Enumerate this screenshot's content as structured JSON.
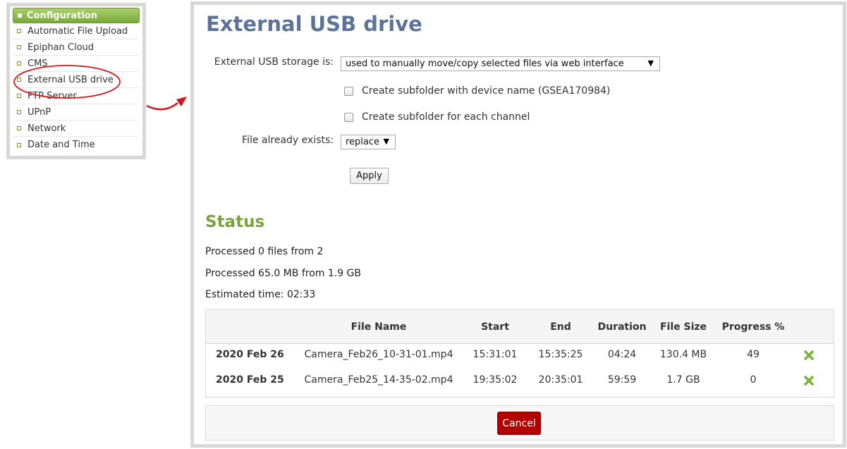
{
  "nav": {
    "header": "Configuration",
    "items": [
      {
        "label": "Automatic File Upload"
      },
      {
        "label": "Epiphan Cloud"
      },
      {
        "label": "CMS"
      },
      {
        "label": "External USB drive"
      },
      {
        "label": "FTP Server"
      },
      {
        "label": "UPnP"
      },
      {
        "label": "Network"
      },
      {
        "label": "Date and Time"
      }
    ]
  },
  "page": {
    "title": "External USB drive",
    "storage_label": "External USB storage is:",
    "storage_value": "used to manually move/copy selected files via web interface",
    "subfolder_device_label": "Create subfolder with device name (GSEA170984)",
    "subfolder_channel_label": "Create subfolder for each channel",
    "file_exists_label": "File already exists:",
    "file_exists_value": "replace",
    "apply_label": "Apply"
  },
  "status": {
    "title": "Status",
    "files_processed": "Processed 0 files from 2",
    "size_processed": "Processed 65.0 MB from 1.9 GB",
    "estimated_time": "Estimated time: 02:33"
  },
  "table": {
    "headers": {
      "file_name": "File Name",
      "start": "Start",
      "end": "End",
      "duration": "Duration",
      "file_size": "File Size",
      "progress": "Progress %"
    },
    "rows": [
      {
        "date": "2020 Feb 26",
        "file_name": "Camera_Feb26_10-31-01.mp4",
        "start": "15:31:01",
        "end": "15:35:25",
        "duration": "04:24",
        "file_size": "130.4 MB",
        "progress": "49"
      },
      {
        "date": "2020 Feb 25",
        "file_name": "Camera_Feb25_14-35-02.mp4",
        "start": "19:35:02",
        "end": "20:35:01",
        "duration": "59:59",
        "file_size": "1.7 GB",
        "progress": "0"
      }
    ]
  },
  "cancel_label": "Cancel",
  "colors": {
    "title_blue": "#5b7498",
    "status_green": "#7aa33c",
    "cancel_red": "#b40000",
    "annotation_red": "#d9141b"
  }
}
